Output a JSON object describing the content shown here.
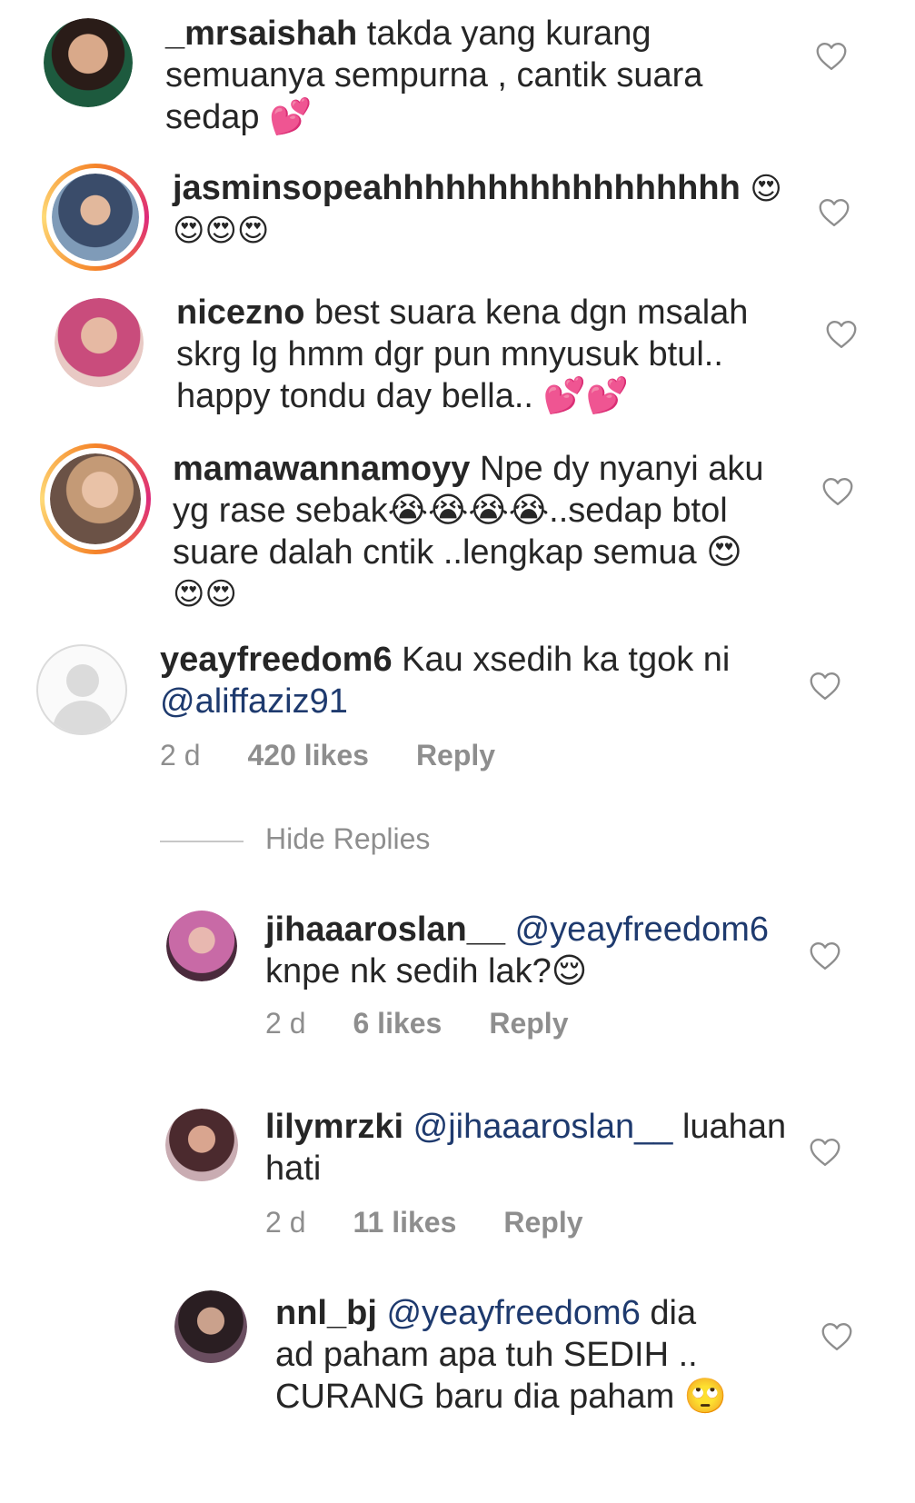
{
  "comments": [
    {
      "username": "_mrsaishah",
      "lines": [
        "takda yang kurang",
        "semuanya sempurna , cantik suara",
        "sedap 💕"
      ]
    },
    {
      "username": "jasminsopeahhhhhhhhhhhhhhhhh",
      "emoji_line1": "😍",
      "emoji_line2": "😍😍😍"
    },
    {
      "username": "nicezno",
      "lines": [
        "best suara kena dgn msalah",
        "skrg lg hmm dgr pun mnyusuk btul..",
        "happy tondu day bella.. 💕💕"
      ]
    },
    {
      "username": "mamawannamoyy",
      "lines": [
        "Npe dy nyanyi aku",
        "yg rase sebak😭😭😭😭..sedap btol",
        "suare dalah cntik ..lengkap semua 😍",
        "😍😍"
      ]
    },
    {
      "username": "yeayfreedom6",
      "text": "Kau xsedih ka tgok ni",
      "mention": "@aliffaziz91",
      "time": "2 d",
      "likes": "420 likes",
      "reply": "Reply"
    }
  ],
  "hide_replies": "Hide Replies",
  "replies": [
    {
      "username": "jihaaaroslan__",
      "mention": "@yeayfreedom6",
      "line2": "knpe nk sedih lak?😌",
      "time": "2 d",
      "likes": "6 likes",
      "reply": "Reply"
    },
    {
      "username": "lilymrzki",
      "mention": "@jihaaaroslan__",
      "text": "luahan",
      "line2": "hati",
      "time": "2 d",
      "likes": "11 likes",
      "reply": "Reply"
    },
    {
      "username": "nnl_bj",
      "mention": "@yeayfreedom6",
      "text": "dia",
      "line2": "ad paham apa tuh SEDIH ..",
      "line3": "CURANG baru dia paham 🙄"
    }
  ],
  "icons": {
    "like": "heart-outline-icon",
    "default_avatar": "default-avatar-icon"
  },
  "colors": {
    "username": "#262626",
    "mention": "#1e3a6e",
    "meta": "#8e8e8e",
    "story_ring": "#dd2a7b"
  }
}
